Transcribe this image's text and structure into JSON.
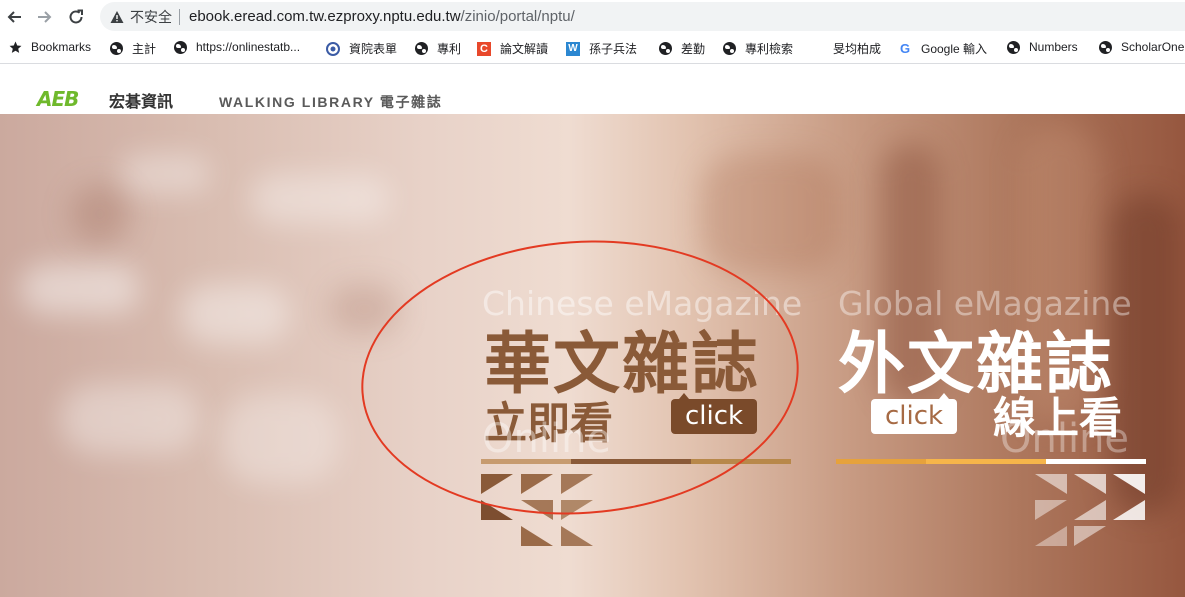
{
  "browser": {
    "security_label": "不安全",
    "url_host": "ebook.eread.com.tw.ezproxy.nptu.edu.tw",
    "url_path": "/zinio/portal/nptu/",
    "bookmarks": [
      {
        "label": "Bookmarks",
        "icon": "star-icon"
      },
      {
        "label": "主計",
        "icon": "globe-icon"
      },
      {
        "label": "https://onlinestatb...",
        "icon": "globe-icon"
      },
      {
        "label": "資院表單",
        "icon": "site-icon"
      },
      {
        "label": "專利",
        "icon": "globe-icon"
      },
      {
        "label": "論文解讀",
        "icon": "c-icon"
      },
      {
        "label": "孫子兵法",
        "icon": "w-icon"
      },
      {
        "label": "差勤",
        "icon": "globe-icon"
      },
      {
        "label": "專利檢索",
        "icon": "globe-icon"
      },
      {
        "label": "旻均柏成",
        "icon": ""
      },
      {
        "label": "Google 輸入",
        "icon": "google-icon"
      },
      {
        "label": "Numbers",
        "icon": "globe-icon"
      },
      {
        "label": "ScholarOne",
        "icon": "globe-icon"
      }
    ]
  },
  "site": {
    "logo_mark": "AEB",
    "logo_text": "宏碁資訊",
    "title": "WALKING LIBRARY 電子雜誌"
  },
  "banner": {
    "chinese": {
      "ghost_top": "Chinese eMagazine",
      "title": "華文雜誌",
      "subtitle": "立即看",
      "ghost_bottom": "Online",
      "button": "click"
    },
    "global": {
      "ghost_top": "Global eMagazine",
      "title": "外文雜誌",
      "subtitle": "線上看",
      "ghost_bottom": "Online",
      "button": "click"
    }
  },
  "colors": {
    "chinese_accent": "#7a4a2a",
    "global_accent": "#f2a43a",
    "annotation_circle": "#e33a22",
    "logo_green": "#6fb92c"
  }
}
